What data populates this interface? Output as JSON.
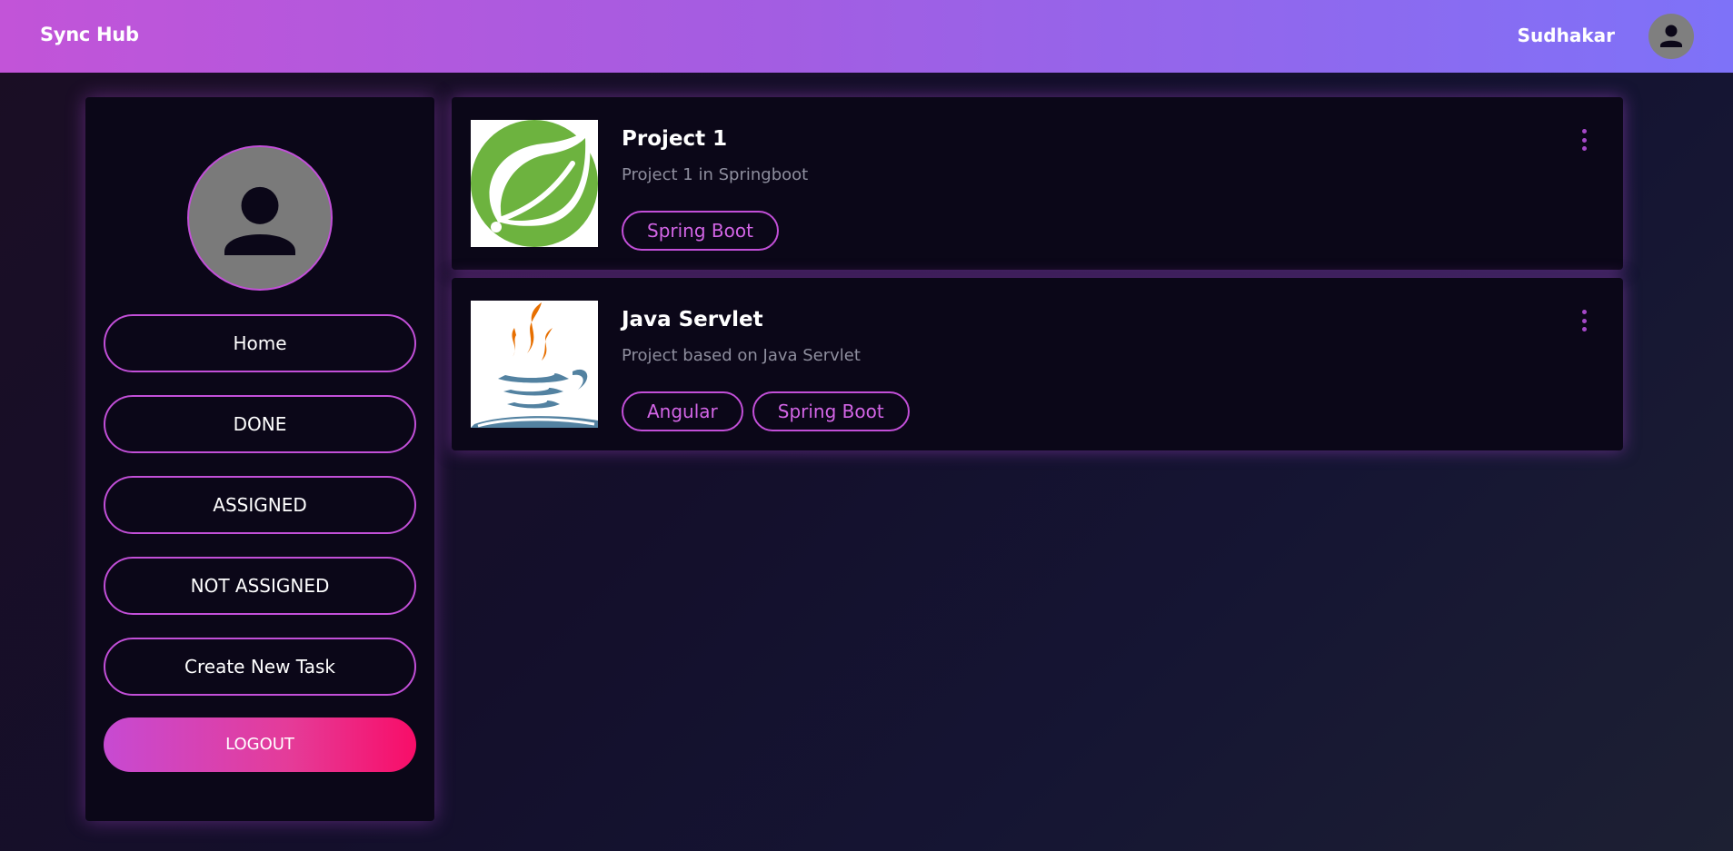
{
  "header": {
    "brand": "Sync Hub",
    "username": "Sudhakar",
    "avatar_icon": "user-avatar-icon"
  },
  "sidebar": {
    "avatar_icon": "user-avatar-icon",
    "nav": [
      {
        "label": "Home"
      },
      {
        "label": "DONE"
      },
      {
        "label": "ASSIGNED"
      },
      {
        "label": "NOT ASSIGNED"
      },
      {
        "label": "Create New Task"
      }
    ],
    "logout_label": "LOGOUT"
  },
  "projects": [
    {
      "title": "Project 1",
      "description": "Project 1 in Springboot",
      "logo": "spring-boot-logo",
      "tags": [
        "Spring Boot"
      ],
      "menu_icon": "more-vertical-icon"
    },
    {
      "title": "Java Servlet",
      "description": "Project based on Java Servlet",
      "logo": "java-logo",
      "tags": [
        "Angular",
        "Spring Boot"
      ],
      "menu_icon": "more-vertical-icon"
    }
  ],
  "colors": {
    "accent": "#c24fd8",
    "tag_text": "#d365e6",
    "logout_gradient_end": "#f80d68",
    "header_gradient_start": "#c254d8",
    "header_gradient_end": "#7e72f8",
    "card_bg": "#0b0718"
  }
}
